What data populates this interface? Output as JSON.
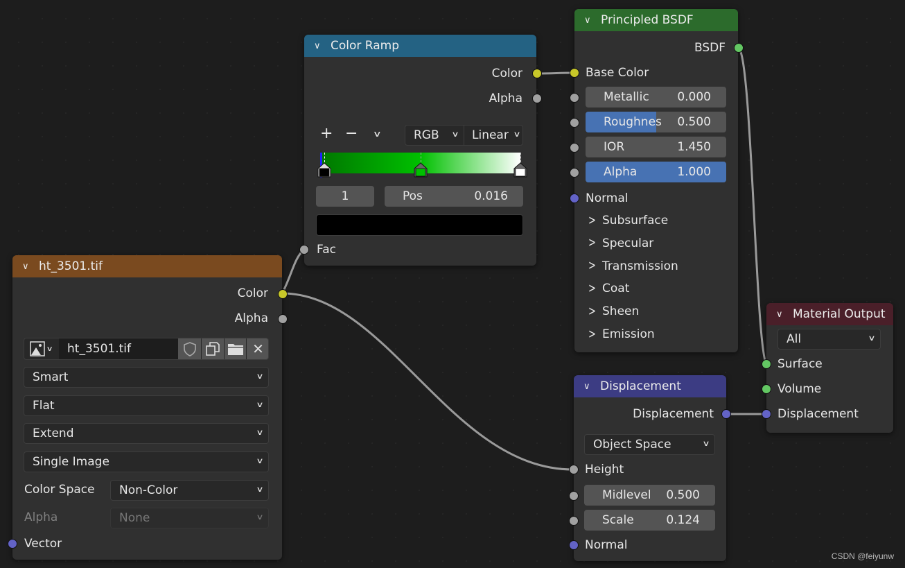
{
  "nodes": {
    "color_ramp": {
      "title": "Color Ramp",
      "header_color": "#246283",
      "outputs": [
        "Color",
        "Alpha"
      ],
      "toolbar": {
        "add": "+",
        "remove": "−",
        "menu": "⌄"
      },
      "color_mode": "RGB",
      "interpolation": "Linear",
      "stops": [
        {
          "position": 0.0,
          "color": "#0000ff"
        },
        {
          "position": 0.016,
          "color": "#000000",
          "active": true
        },
        {
          "position": 0.5,
          "color": "#00c000"
        },
        {
          "position": 1.0,
          "color": "#ffffff"
        }
      ],
      "active_index": "1",
      "pos_label": "Pos",
      "pos_value": "0.016",
      "active_color": "#000000",
      "input": "Fac"
    },
    "principled": {
      "title": "Principled BSDF",
      "header_color": "#2c6b2c",
      "output": "BSDF",
      "base_color": "Base Color",
      "fields": [
        {
          "label": "Metallic",
          "value": "0.000",
          "fill": 0.0
        },
        {
          "label": "Roughnes",
          "value": "0.500",
          "fill": 0.5
        },
        {
          "label": "IOR",
          "value": "1.450",
          "fill": 0.0
        },
        {
          "label": "Alpha",
          "value": "1.000",
          "fill": 1.0
        }
      ],
      "normal": "Normal",
      "panels": [
        "Subsurface",
        "Specular",
        "Transmission",
        "Coat",
        "Sheen",
        "Emission"
      ]
    },
    "image": {
      "title": "ht_3501.tif",
      "header_color": "#7a4a1f",
      "outputs": [
        "Color",
        "Alpha"
      ],
      "image_name": "ht_3501.tif",
      "interpolation": "Smart",
      "projection": "Flat",
      "extension": "Extend",
      "source": "Single Image",
      "color_space_label": "Color Space",
      "color_space": "Non-Color",
      "alpha_label": "Alpha",
      "alpha": "None",
      "input": "Vector"
    },
    "displacement": {
      "title": "Displacement",
      "header_color": "#3c3c83",
      "output": "Displacement",
      "space": "Object Space",
      "height": "Height",
      "fields": [
        {
          "label": "Midlevel",
          "value": "0.500"
        },
        {
          "label": "Scale",
          "value": "0.124"
        }
      ],
      "normal": "Normal"
    },
    "material_output": {
      "title": "Material Output",
      "header_color": "#4a1f29",
      "target": "All",
      "inputs": [
        "Surface",
        "Volume",
        "Displacement"
      ]
    }
  },
  "watermark": "CSDN @feiyunw"
}
